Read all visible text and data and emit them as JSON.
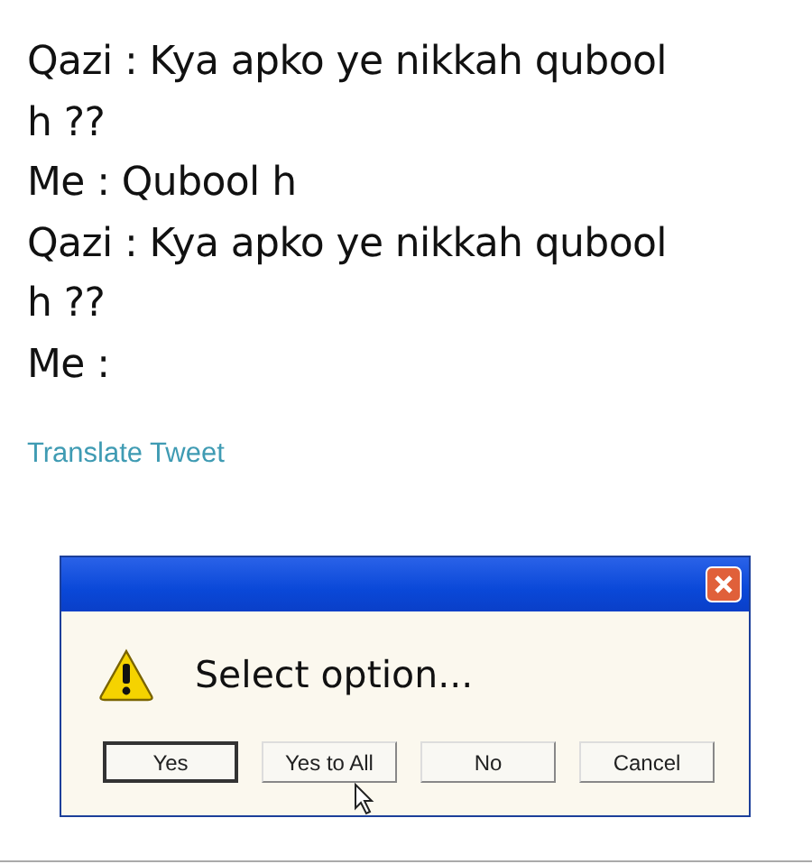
{
  "tweet": {
    "lines": [
      "Qazi : Kya apko ye nikkah qubool",
      "h ??",
      "Me : Qubool h",
      "Qazi : Kya apko ye nikkah qubool",
      "h ??",
      "Me :"
    ],
    "translate_link": "Translate Tweet"
  },
  "dialog": {
    "message": "Select option...",
    "buttons": [
      {
        "label": "Yes",
        "focused": true
      },
      {
        "label": "Yes to All",
        "focused": false
      },
      {
        "label": "No",
        "focused": false
      },
      {
        "label": "Cancel",
        "focused": false
      }
    ]
  }
}
